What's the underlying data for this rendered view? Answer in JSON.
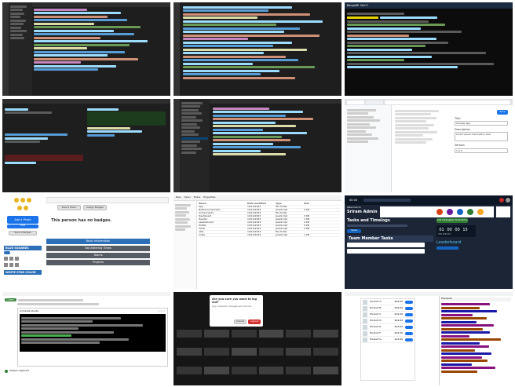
{
  "tiles": {
    "t3": {
      "title": "MongoDB Shell",
      "banner": "Current Mongosh Log ID"
    },
    "t6": {
      "form_fields": [
        "Title",
        "Description",
        "Version"
      ],
      "field_values": [
        "Sample App",
        "Lorem ipsum description text",
        "1.0.0"
      ],
      "button": "Save"
    },
    "t7": {
      "coins_count": 5,
      "actions": [
        "Select Photo",
        "Assign Badges"
      ],
      "empty_msg": "This person has no badges.",
      "left_buttons": [
        "Add a Photo",
        "Edit",
        "Save Changes"
      ],
      "left_labels": [
        "BLUE SQUARES",
        "WHITE STAR COLOR"
      ],
      "info_buttons": [
        "Basic Information",
        "Volunteering Times",
        "Teams",
        "Projects"
      ]
    },
    "t8": {
      "toolbar": [
        "New",
        "Open",
        "Share",
        "Properties"
      ],
      "columns": [
        "Name",
        "Date modified",
        "Type",
        "Size"
      ],
      "rows": [
        [
          "App",
          "10/12/2023",
          "File folder",
          ""
        ],
        [
          "ButtonComponent",
          "10/12/2023",
          "JavaScript",
          "2 KB"
        ],
        [
          "Components",
          "10/12/2023",
          "File folder",
          ""
        ],
        [
          "Dashboard",
          "10/12/2023",
          "JavaScript",
          "3 KB"
        ],
        [
          "Header",
          "10/12/2023",
          "JavaScript",
          "1 KB"
        ],
        [
          "Leaderboard",
          "10/12/2023",
          "JavaScript",
          "4 KB"
        ],
        [
          "Profile",
          "10/12/2023",
          "JavaScript",
          "5 KB"
        ],
        [
          "Timer",
          "10/12/2023",
          "JavaScript",
          "2 KB"
        ],
        [
          "utils",
          "10/12/2023",
          "File folder",
          ""
        ],
        [
          "index",
          "10/12/2023",
          "JavaScript",
          "1 KB"
        ]
      ]
    },
    "t9": {
      "greeting": "Sriram Admin",
      "welcome": "Welcome to",
      "section": "Tasks and Timelogs",
      "team_tasks": "Team Member Tasks",
      "leaderboard": "Leaderboard",
      "timer": [
        "01",
        "00",
        "00",
        "15"
      ],
      "timer_label": "HRS MIN SEC",
      "log_btn": "Add Intangible Time Entry"
    },
    "t10": {
      "badge": "Green",
      "dropdown": "Compute Quota",
      "status": "Output captured"
    },
    "t11": {
      "dialog_title": "Are you sure you want to log out?",
      "dialog_text": "Any unsaved changes will be lost.",
      "cancel": "Cancel",
      "confirm": "Logout"
    },
    "t12": {
      "panel": "Elements",
      "products": [
        "Product A",
        "Product B",
        "Product C",
        "Product D",
        "Product E",
        "Product F",
        "Product G"
      ],
      "prices": [
        "$29.99",
        "$39.99",
        "$19.99",
        "$49.99",
        "$24.99",
        "$34.99",
        "$14.99"
      ]
    }
  },
  "colors": {
    "editor_bg": "#1e1e1e",
    "accent_blue": "#1a73e8",
    "dashboard_bg": "#1b2536",
    "badge_green": "#2e7d32"
  }
}
